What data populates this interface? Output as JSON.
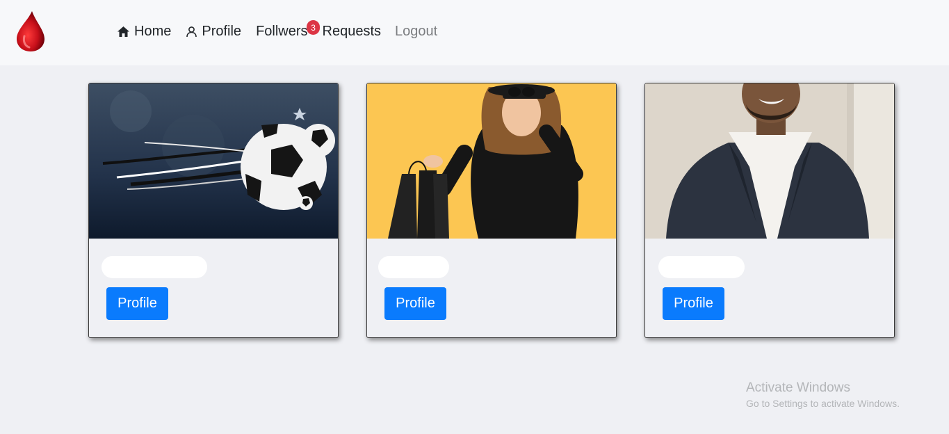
{
  "nav": {
    "home_label": "Home",
    "profile_label": "Profile",
    "followers_label": "Follwers",
    "followers_badge": "3",
    "requests_label": "Requests",
    "logout_label": "Logout"
  },
  "cards": [
    {
      "button_label": "Profile",
      "image": "soccer-ball-image"
    },
    {
      "button_label": "Profile",
      "image": "woman-with-shopping-bags-image"
    },
    {
      "button_label": "Profile",
      "image": "man-in-suit-image"
    }
  ],
  "watermark": {
    "title": "Activate Windows",
    "subtitle": "Go to Settings to activate Windows."
  },
  "colors": {
    "primary_button": "#0a7bfd",
    "badge": "#dc3545",
    "logo_red": "#c8101a"
  }
}
